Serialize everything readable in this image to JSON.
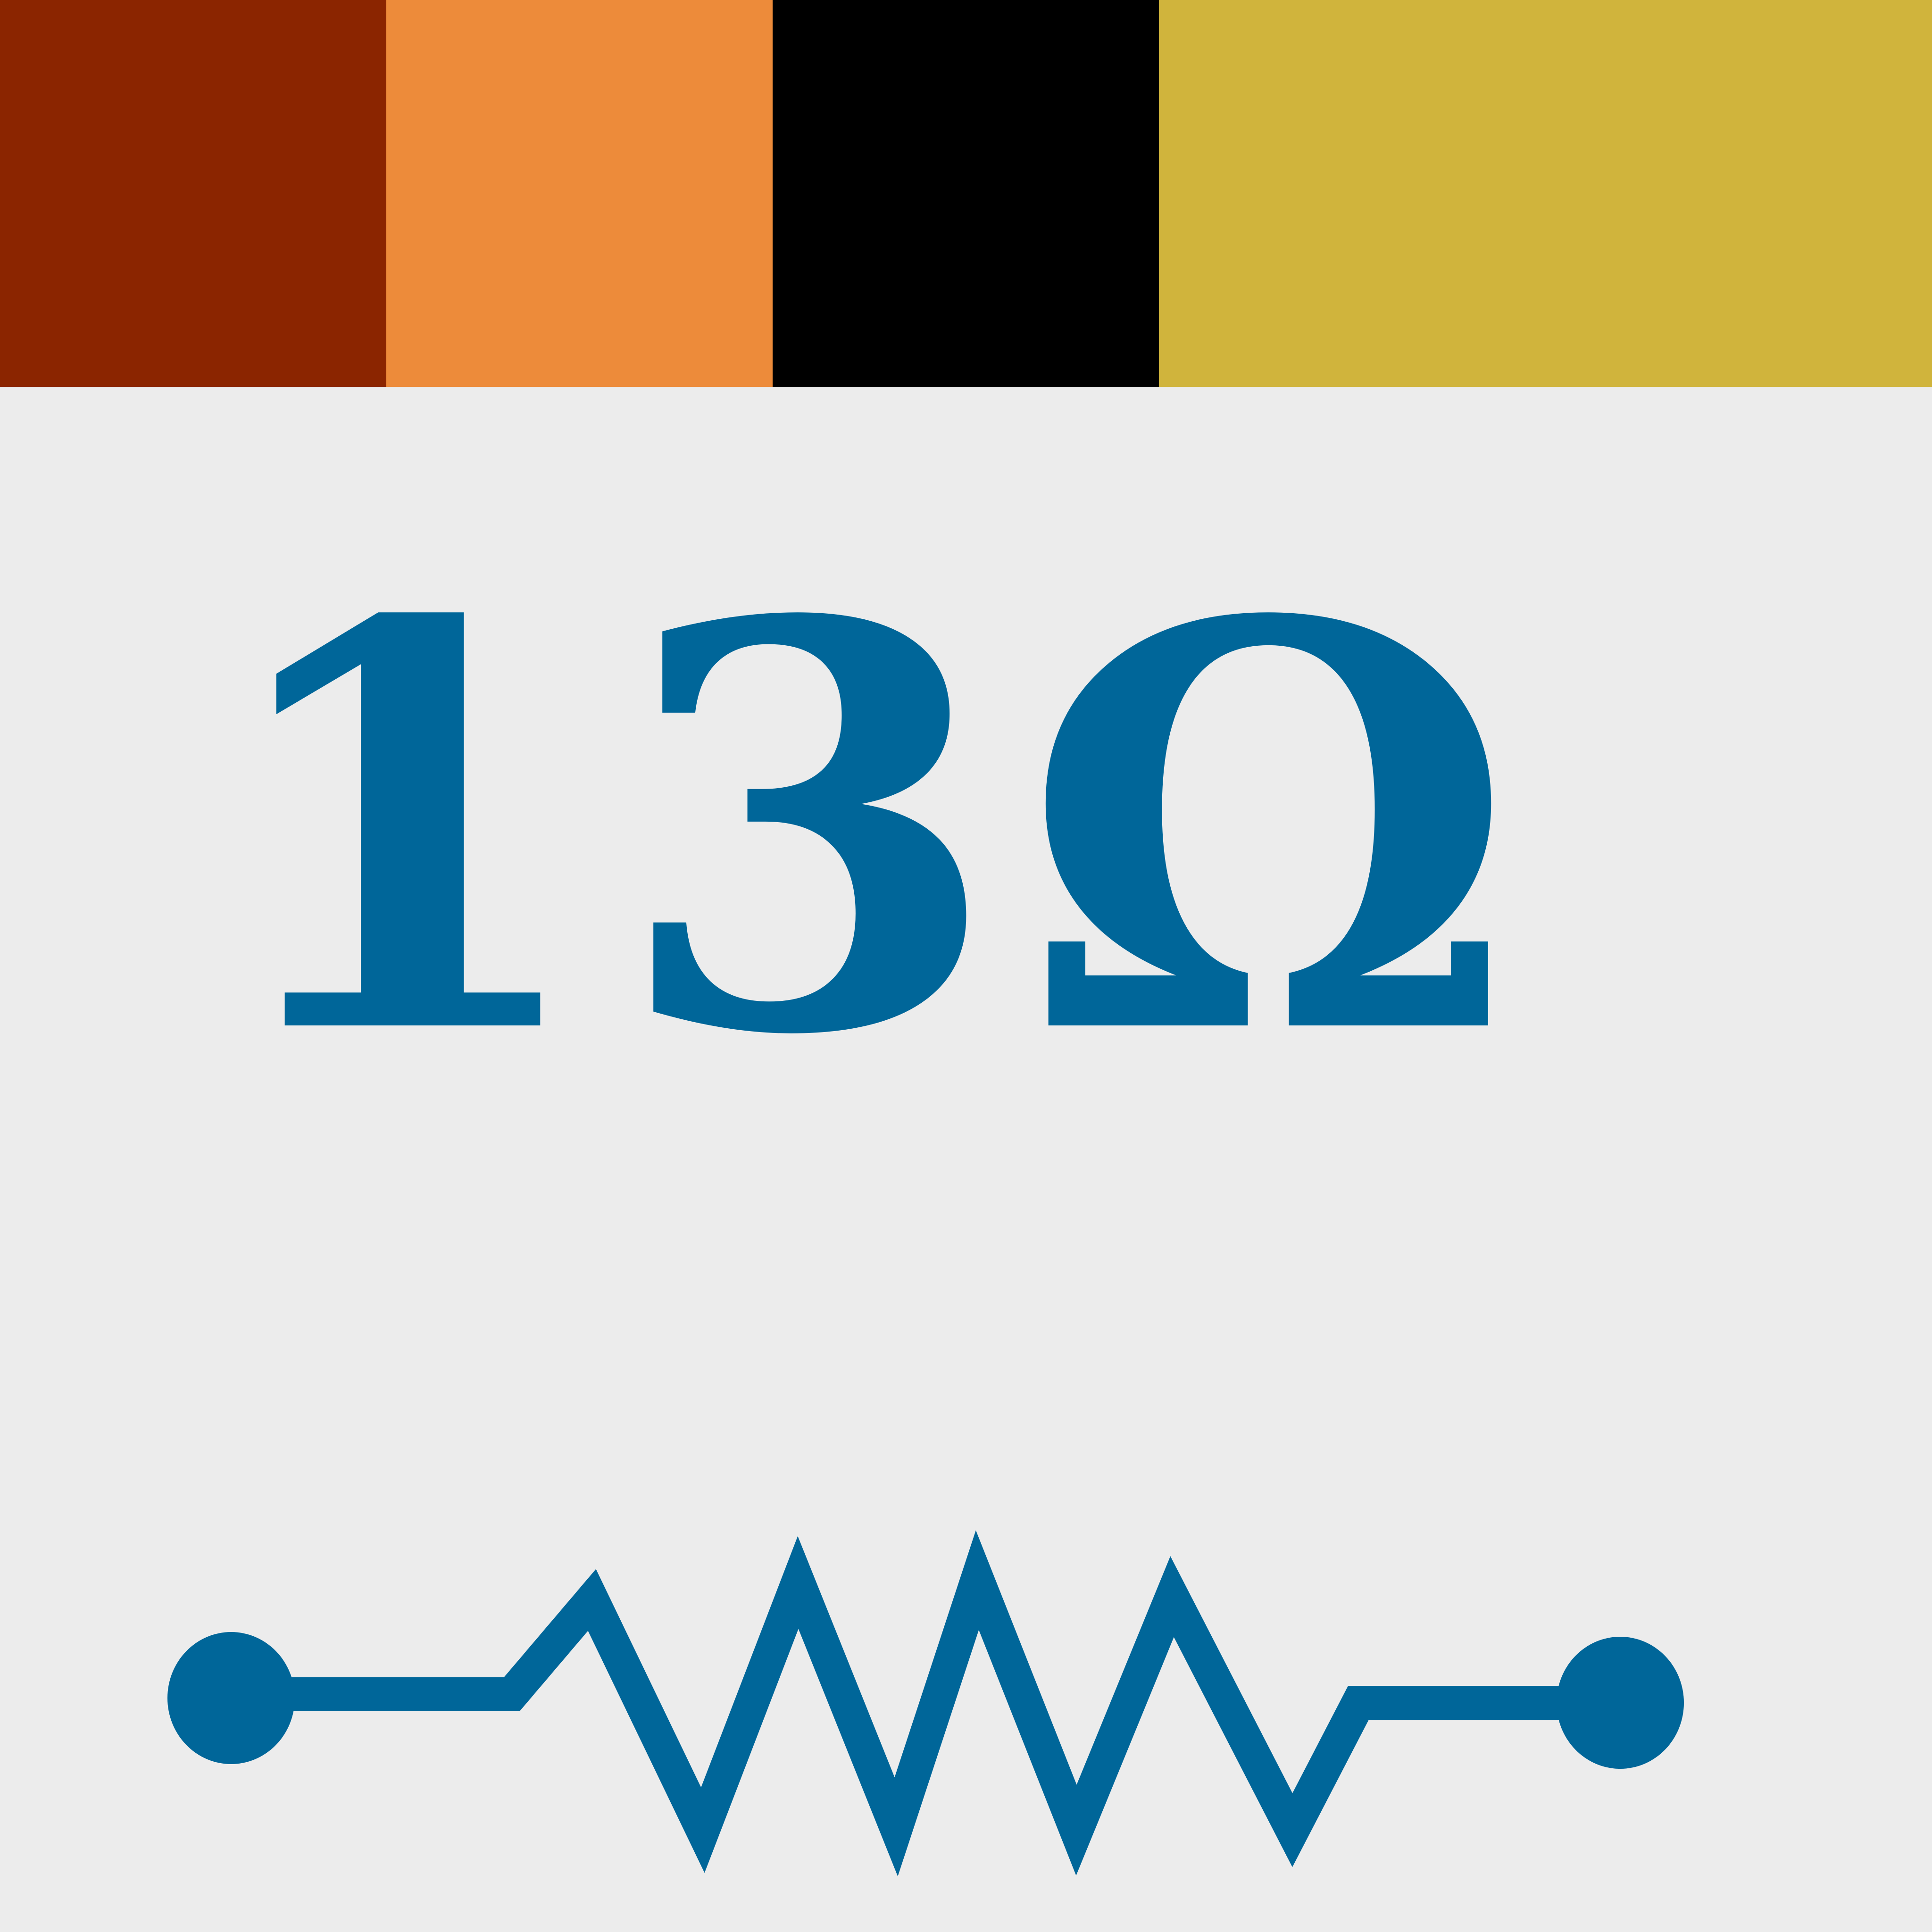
{
  "bands": [
    {
      "color": "#8b2500"
    },
    {
      "color": "#ed8b3a"
    },
    {
      "color": "#000000"
    },
    {
      "color": "#d0b43c"
    }
  ],
  "value_label": "13Ω",
  "colors": {
    "background": "#ececec",
    "accent": "#006699"
  },
  "icons": {
    "symbol": "resistor-symbol-icon"
  }
}
